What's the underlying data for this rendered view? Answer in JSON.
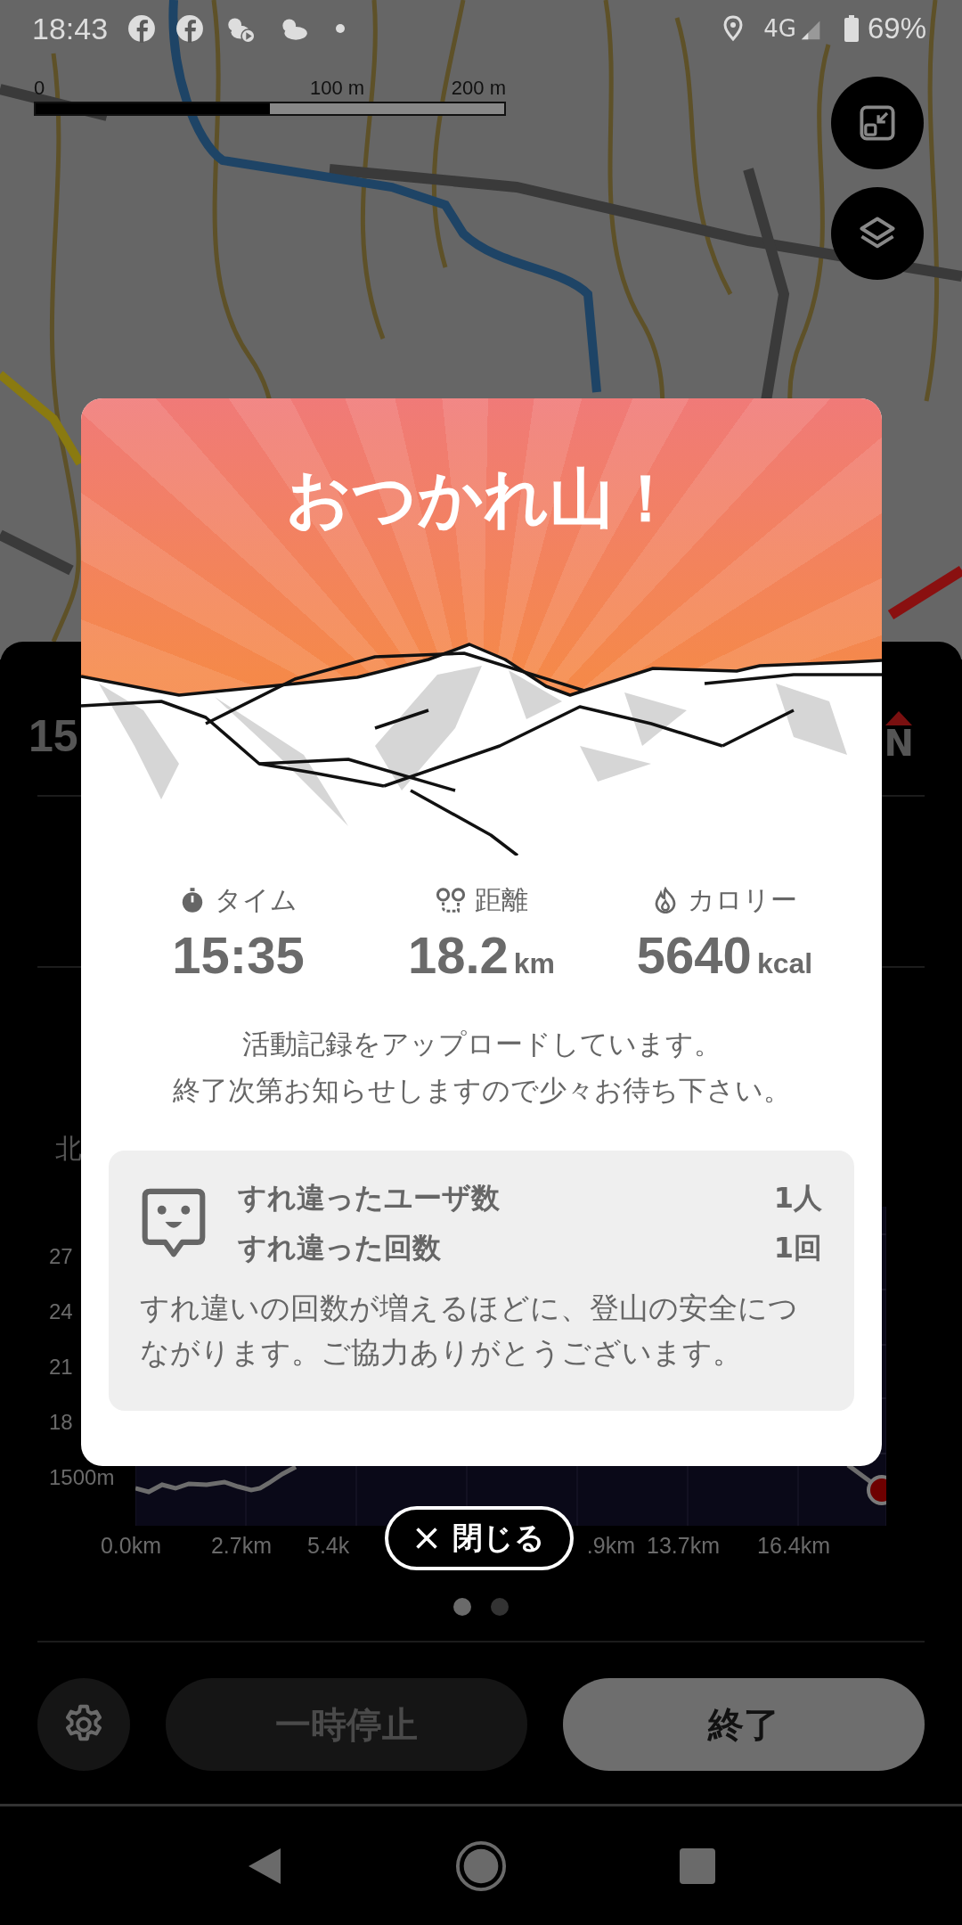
{
  "status_bar": {
    "time": "18:43",
    "network": "4G",
    "battery": "69%"
  },
  "map": {
    "scale_labels": [
      "0",
      "100 m",
      "200 m"
    ]
  },
  "panel": {
    "time_fragment": "15",
    "compass": "N",
    "label_fragment": "北",
    "elevation_labels": [
      "27",
      "24",
      "21",
      "18",
      "1500m"
    ],
    "distance_labels": [
      "0.0km",
      "2.7km",
      "5.4k",
      ".9km",
      "13.7km",
      "16.4km"
    ]
  },
  "page_dots": [
    {
      "selected": true
    },
    {
      "selected": false
    }
  ],
  "controls": {
    "pause": "一時停止",
    "finish": "終了"
  },
  "dialog": {
    "title": "おつかれ山！",
    "stats": [
      {
        "kind": "time",
        "label": "タイム",
        "value": "15:35"
      },
      {
        "kind": "distance",
        "label": "距離",
        "value": "18.2",
        "unit": "km"
      },
      {
        "kind": "calorie",
        "label": "カロリー",
        "value": "5640",
        "unit": "kcal"
      }
    ],
    "message": [
      "活動記録をアップロードしています。",
      "終了次第お知らせしますので少々お待ち下さい。"
    ],
    "encounter": {
      "rows": [
        {
          "label": "すれ違ったユーザ数",
          "value": "1人"
        },
        {
          "label": "すれ違った回数",
          "value": "1回"
        }
      ],
      "note": "すれ違いの回数が増えるほどに、登山の安全につながります。ご協力ありがとうございます。"
    },
    "close": "閉じる"
  }
}
